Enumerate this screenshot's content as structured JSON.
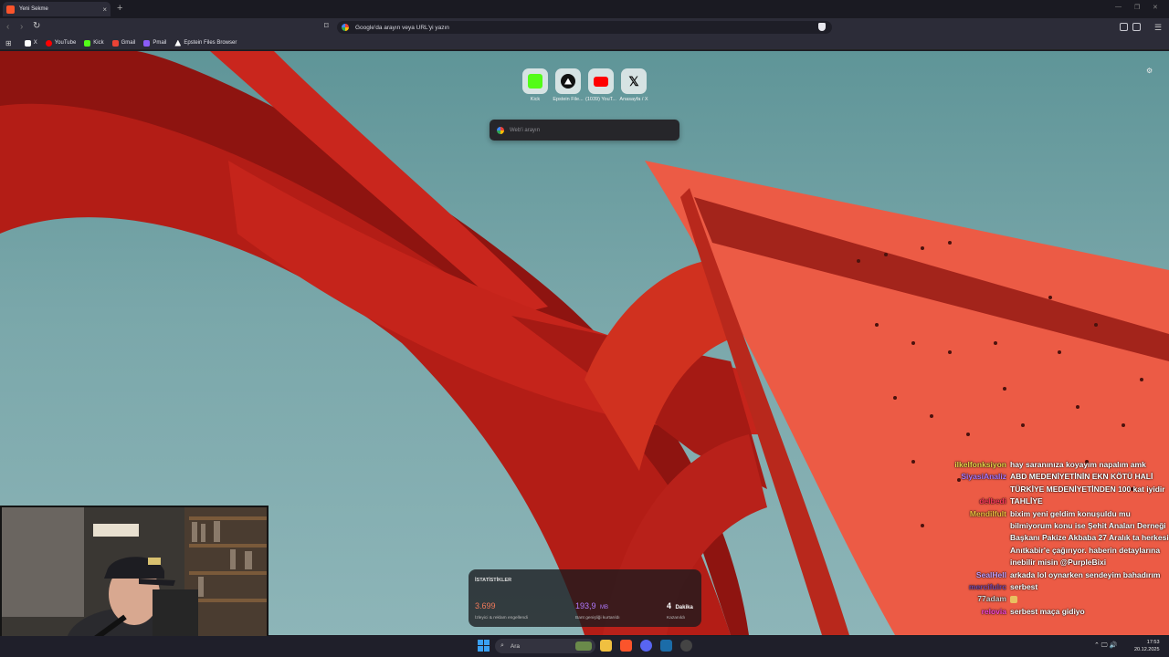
{
  "browser": {
    "tab": {
      "title": "Yeni Sekme"
    },
    "new_tab_symbol": "+",
    "omnibox": {
      "placeholder": "Google'da arayın veya URL'yi yazın"
    },
    "bookmarks": [
      {
        "label": "X",
        "icon": "x-icon",
        "color": "#ffffff"
      },
      {
        "label": "YouTube",
        "icon": "youtube-icon",
        "color": "#ff0000"
      },
      {
        "label": "Kick",
        "icon": "kick-icon",
        "color": "#53fc18"
      },
      {
        "label": "Gmail",
        "icon": "gmail-icon",
        "color": "#ea4335"
      },
      {
        "label": "Pmail",
        "icon": "pmail-icon",
        "color": "#8b5cf6"
      },
      {
        "label": "Epstein Files Browser",
        "icon": "triangle-icon",
        "color": "#ffffff"
      }
    ]
  },
  "newtab": {
    "top_sites": [
      {
        "label": "Kick",
        "icon": "kick-icon"
      },
      {
        "label": "Epstein File...",
        "icon": "triangle-icon"
      },
      {
        "label": "(1039) YouT...",
        "icon": "youtube-icon"
      },
      {
        "label": "Anasayfa / X",
        "icon": "x-icon"
      }
    ],
    "search_placeholder": "Web'i arayın",
    "stats": {
      "title": "İSTATİSTİKLER",
      "blocked": {
        "value": "3.699",
        "desc": "İzleyici & reklam engellendi",
        "color": "#f07a5b"
      },
      "bandwidth": {
        "value": "193,9",
        "unit": "MB",
        "desc": "Bant genişliği kurtarıldı",
        "color": "#b07aff"
      },
      "time": {
        "value": "4",
        "unit": "Dakika",
        "desc": "Kazanıldı",
        "color": "#ffffff"
      }
    }
  },
  "chat": [
    {
      "user": "ilkelfonksiyon",
      "color": "#e8d84a",
      "text": "hay saranınıza koyayım napalım amk"
    },
    {
      "user": "SiyasiAnaliz",
      "color": "#b07aff",
      "text": "ABD MEDENİYETİNİN EKN KÖTÜ HALİ TÜRKİYE MEDENİYETİNDEN 100 kat iyidir"
    },
    {
      "user": "delbedi",
      "color": "#ff3a5c",
      "text": "TAHLİYE"
    },
    {
      "user": "Mendilfult",
      "color": "#f0c040",
      "text": "bixim yeni geldim konuşuldu mu bilmiyorum konu ise Şehit Anaları Derneği Başkanı Pakize Akbaba 27 Aralık ta herkesi Anıtkabir'e çağırıyor. haberin detaylarına inebilir misin @PurpleBixi"
    },
    {
      "user": "SealHell",
      "color": "#c0a0ff",
      "text": "arkada lol oynarken sendeyim bahadırım"
    },
    {
      "user": "mercifulrc",
      "color": "#7a4aa8",
      "text": "serbest"
    },
    {
      "user": "77adam",
      "color": "#d0d0d0",
      "text": ""
    },
    {
      "user": "relovia",
      "color": "#ff4ad8",
      "text": "serbest maça gidiyo"
    }
  ],
  "taskbar": {
    "search_label": "Ara",
    "time": "17:53",
    "date": "20.12.2025"
  }
}
